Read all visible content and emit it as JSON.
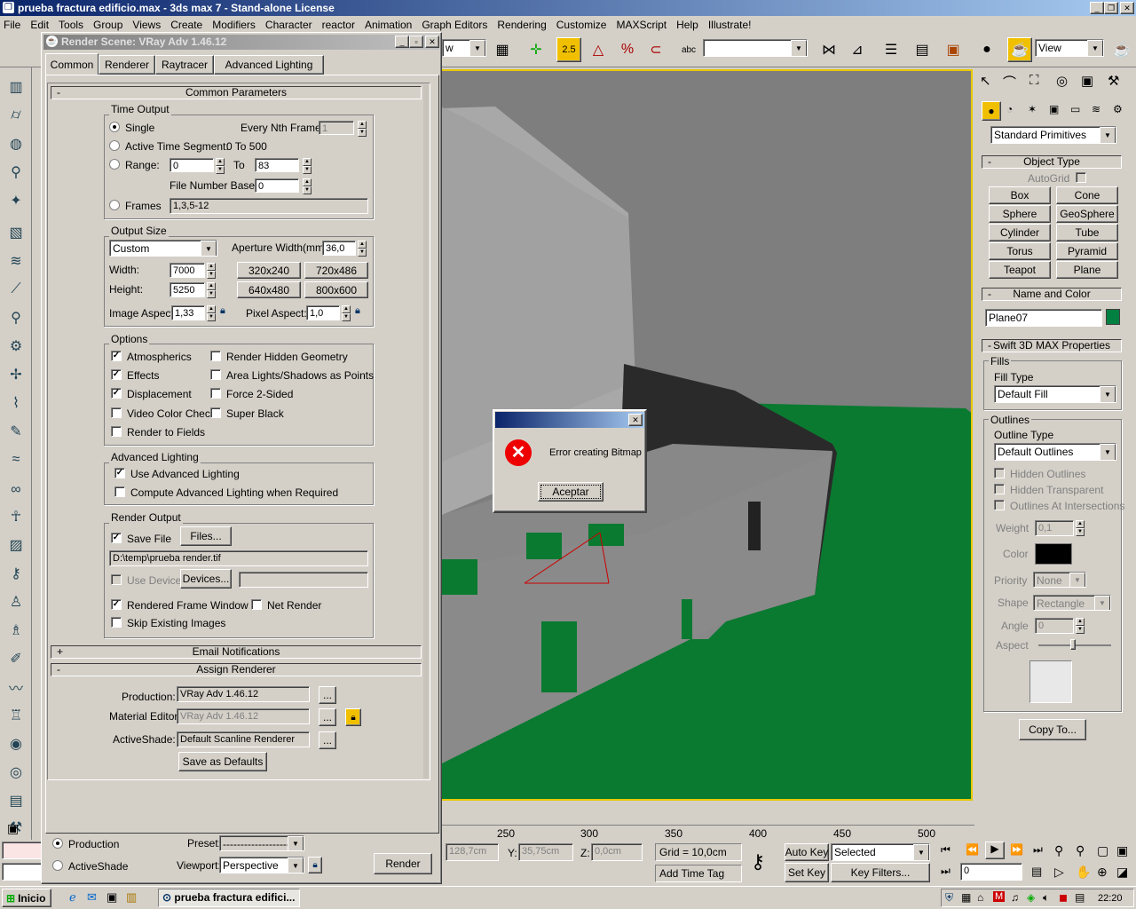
{
  "app": {
    "title": "prueba fractura edificio.max - 3ds max 7 - Stand-alone License",
    "menu": [
      "File",
      "Edit",
      "Tools",
      "Group",
      "Views",
      "Create",
      "Modifiers",
      "Character",
      "reactor",
      "Animation",
      "Graph Editors",
      "Rendering",
      "Customize",
      "MAXScript",
      "Help",
      "Illustrate!"
    ],
    "view_dropdown": "View",
    "snap_label": "2.5"
  },
  "render_dialog": {
    "title": "Render Scene: VRay Adv 1.46.12",
    "tabs": [
      "Common",
      "Renderer",
      "Raytracer",
      "Advanced Lighting"
    ],
    "common_params": "Common Parameters",
    "time_output": {
      "title": "Time Output",
      "single": "Single",
      "every_nth": "Every Nth Frame:",
      "every_nth_val": "1",
      "active_segment": "Active Time Segment:",
      "active_segment_val": "0 To 500",
      "range": "Range:",
      "range_from": "0",
      "to": "To",
      "range_to": "83",
      "file_base": "File Number Base:",
      "file_base_val": "0",
      "frames": "Frames",
      "frames_val": "1,3,5-12"
    },
    "output_size": {
      "title": "Output Size",
      "preset": "Custom",
      "aperture": "Aperture Width(mm):",
      "aperture_val": "36,0",
      "width": "Width:",
      "width_val": "7000",
      "height": "Height:",
      "height_val": "5250",
      "presets": [
        "320x240",
        "720x486",
        "640x480",
        "800x600"
      ],
      "image_aspect": "Image Aspect:",
      "image_aspect_val": "1,33",
      "pixel_aspect": "Pixel Aspect:",
      "pixel_aspect_val": "1,0"
    },
    "options": {
      "title": "Options",
      "atmospherics": "Atmospherics",
      "effects": "Effects",
      "displacement": "Displacement",
      "video_color": "Video Color Check",
      "render_fields": "Render to Fields",
      "hidden_geo": "Render Hidden Geometry",
      "area_lights": "Area Lights/Shadows as Points",
      "force2": "Force 2-Sided",
      "super_black": "Super Black"
    },
    "adv_lighting": {
      "title": "Advanced Lighting",
      "use": "Use Advanced Lighting",
      "compute": "Compute Advanced Lighting when Required"
    },
    "render_output": {
      "title": "Render Output",
      "save_file": "Save File",
      "files": "Files...",
      "path": "D:\\temp\\prueba render.tif",
      "use_device": "Use Device",
      "devices": "Devices...",
      "rendered_frame": "Rendered Frame Window",
      "net_render": "Net Render",
      "skip_existing": "Skip Existing Images"
    },
    "email": "Email Notifications",
    "assign": {
      "title": "Assign Renderer",
      "production": "Production:",
      "production_val": "VRay Adv 1.46.12",
      "material": "Material Editor:",
      "material_val": "VRay Adv 1.46.12",
      "activeshade": "ActiveShade:",
      "activeshade_val": "Default Scanline Renderer",
      "save_defaults": "Save as Defaults",
      "dots": "..."
    },
    "bottom": {
      "production": "Production",
      "activeshade": "ActiveShade",
      "preset_label": "Preset:",
      "preset_val": "--------------------",
      "viewport_label": "Viewport:",
      "viewport_val": "Perspective",
      "render": "Render"
    }
  },
  "error_dialog": {
    "message": "Error creating Bitmap",
    "ok": "Aceptar",
    "close": "✕"
  },
  "command_panel": {
    "category": "Standard Primitives",
    "object_type": "Object Type",
    "autogrid": "AutoGrid",
    "buttons": [
      "Box",
      "Cone",
      "Sphere",
      "GeoSphere",
      "Cylinder",
      "Tube",
      "Torus",
      "Pyramid",
      "Teapot",
      "Plane"
    ],
    "name_color": "Name and Color",
    "name_val": "Plane07",
    "object_color": "#008040",
    "swift": "Swift 3D MAX Properties",
    "fills": "Fills",
    "fill_type": "Fill Type",
    "fill_val": "Default Fill",
    "outlines": "Outlines",
    "outline_type": "Outline Type",
    "outline_val": "Default Outlines",
    "hidden_outlines": "Hidden Outlines",
    "hidden_transparent": "Hidden Transparent",
    "outlines_at": "Outlines At Intersections",
    "weight": "Weight",
    "weight_val": "0,1",
    "color": "Color",
    "priority": "Priority",
    "priority_val": "None",
    "shape": "Shape",
    "shape_val": "Rectangle",
    "angle": "Angle",
    "angle_val": "0",
    "aspect": "Aspect",
    "copy_to": "Copy To..."
  },
  "status": {
    "x": "128,7cm",
    "y_label": "Y:",
    "y": "35,75cm",
    "z_label": "Z:",
    "z": "0,0cm",
    "grid": "Grid = 10,0cm",
    "auto_key": "Auto Key",
    "selected": "Selected",
    "set_key": "Set Key",
    "key_filters": "Key Filters...",
    "add_time_tag": "Add Time Tag",
    "frame": "0",
    "timeline": [
      "250",
      "300",
      "350",
      "400",
      "450",
      "500"
    ]
  },
  "taskbar": {
    "start": "Inicio",
    "task": "prueba fractura edifici...",
    "clock": "22:20"
  }
}
